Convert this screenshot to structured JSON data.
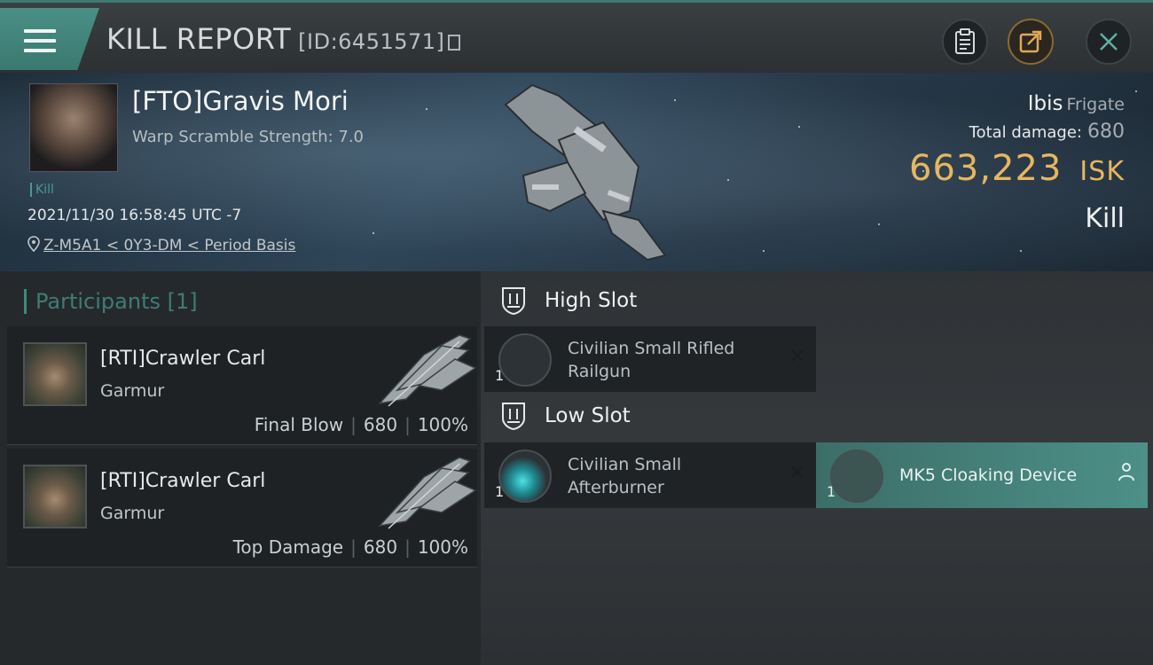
{
  "header": {
    "title": "KILL REPORT",
    "report_id": "[ID:6451571]"
  },
  "victim": {
    "name": "[FTO]Gravis Mori",
    "warp_scramble": "Warp Scramble Strength: 7.0",
    "tag": "Kill",
    "datetime": "2021/11/30 16:58:45 UTC -7",
    "location": "Z-M5A1 < 0Y3-DM < Period Basis",
    "ship_name": "Ibis",
    "ship_class": "Frigate",
    "total_damage_label": "Total damage:",
    "total_damage_value": "680",
    "isk_value": "663,223",
    "isk_unit": "ISK",
    "kill_type": "Kill"
  },
  "participants": {
    "title": "Participants [1]",
    "rows": [
      {
        "name": "[RTI]Crawler Carl",
        "ship": "Garmur",
        "role": "Final Blow",
        "damage": "680",
        "percent": "100%"
      },
      {
        "name": "[RTI]Crawler Carl",
        "ship": "Garmur",
        "role": "Top Damage",
        "damage": "680",
        "percent": "100%"
      }
    ]
  },
  "fitting": {
    "high_slot": {
      "label": "High Slot",
      "modules": [
        {
          "name": "Civilian Small Rifled Railgun",
          "qty": "1",
          "status": "destroyed"
        }
      ]
    },
    "low_slot": {
      "label": "Low Slot",
      "modules": [
        {
          "name": "Civilian Small Afterburner",
          "qty": "1",
          "status": "destroyed"
        },
        {
          "name": "MK5 Cloaking Device",
          "qty": "1",
          "status": "dropped"
        }
      ]
    }
  },
  "colors": {
    "accent": "#4a8f86",
    "isk": "#e8b660",
    "dropped": "#4c9088"
  },
  "icons": [
    "menu-icon",
    "copy-icon",
    "clipboard-icon",
    "share-icon",
    "close-icon",
    "location-pin-icon",
    "slot-icon",
    "destroyed-x-icon",
    "person-icon"
  ]
}
